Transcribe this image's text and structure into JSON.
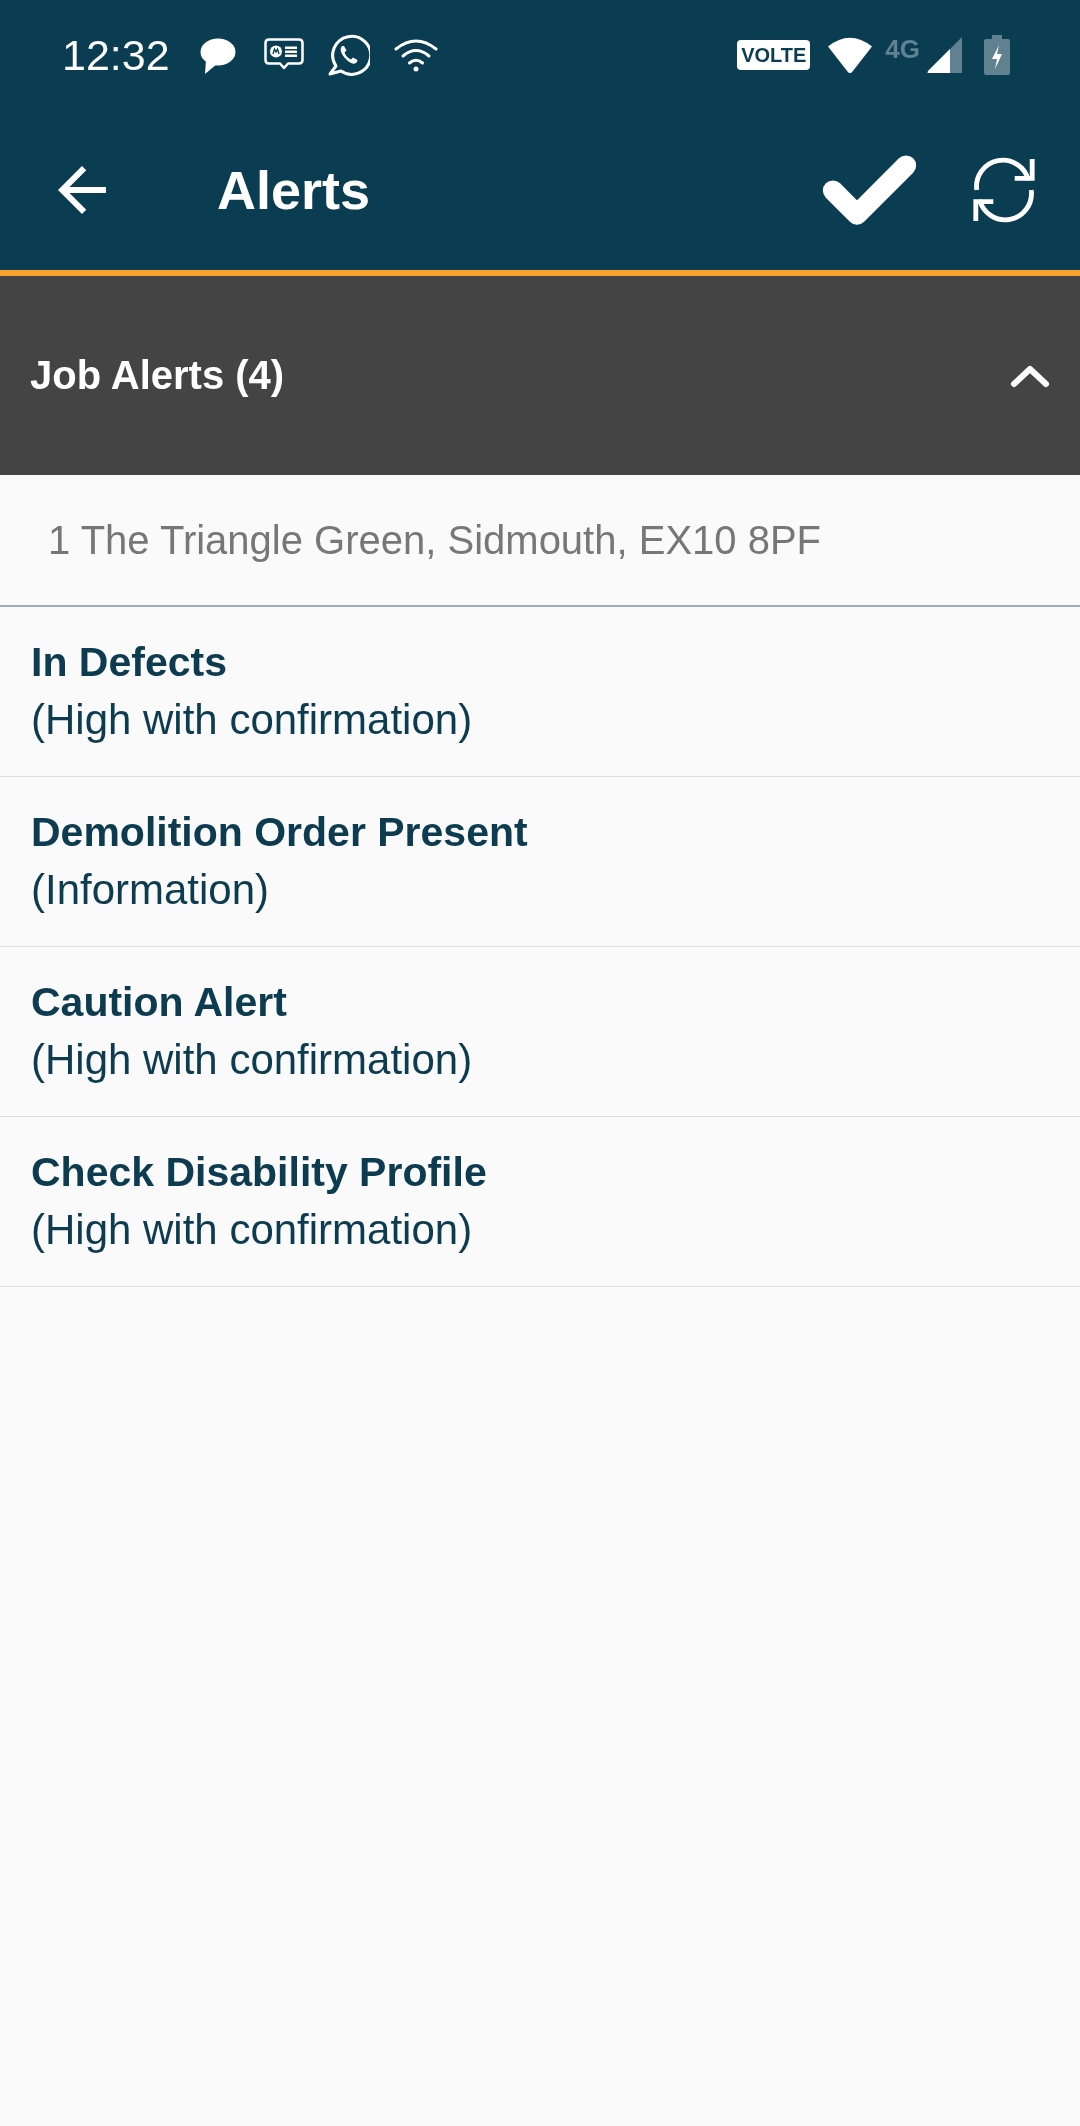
{
  "status_bar": {
    "time": "12:32",
    "network_badge": "VOLTE",
    "network_type": "4G"
  },
  "toolbar": {
    "title": "Alerts"
  },
  "section": {
    "title": "Job Alerts (4)",
    "expanded": true,
    "address": "1 The Triangle Green, Sidmouth, EX10 8PF",
    "alerts": [
      {
        "title": "In Defects",
        "priority": "(High with confirmation)"
      },
      {
        "title": "Demolition Order Present",
        "priority": "(Information)"
      },
      {
        "title": "Caution Alert",
        "priority": "(High with confirmation)"
      },
      {
        "title": "Check Disability Profile",
        "priority": "(High with confirmation)"
      }
    ]
  }
}
